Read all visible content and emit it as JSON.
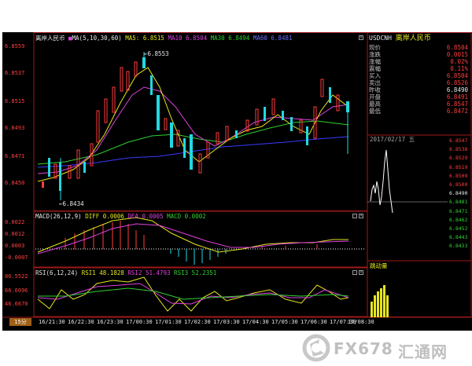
{
  "chart_header": {
    "title": "离岸人民币",
    "ma_label": "MA(5,10,30,60)",
    "ma5": "MA5: 6.8515",
    "ma10": "MA10 6.8504",
    "ma30": "MA30 6.8494",
    "ma60": "MA60 6.8481"
  },
  "price_axis": [
    "6.8559",
    "6.8537",
    "6.8515",
    "6.8493",
    "6.8471",
    "6.8450"
  ],
  "high_label": "6.8553",
  "low_label": "6.8434",
  "macd_header": {
    "label": "MACD(26,12,9)",
    "diff": "DIFF 0.0006",
    "dea": "DEA 0.0005",
    "macd": "MACD 0.0002"
  },
  "macd_axis": [
    "0.0022",
    "0.0012",
    "0.0003",
    "-0.0007"
  ],
  "rsi_header": {
    "label": "RSI(6,12,24)",
    "rsi1": "RSI1 48.1828",
    "rsi2": "RSI2 51.4793",
    "rsi3": "RSI3 52.2351"
  },
  "rsi_axis": [
    "86.5522",
    "66.6096",
    "46.6670"
  ],
  "time_axis": [
    "16/21:30",
    "16/22:30",
    "16/23:30",
    "17/00:30",
    "17/01:30",
    "17/02:30",
    "17/03:30",
    "17/04:30",
    "17/05:30",
    "17/06:30",
    "17/07:30",
    "17/08:30"
  ],
  "period": "15分",
  "quote_panel": {
    "symbol": "USDCNH",
    "name": "离岸人民币",
    "rows": [
      {
        "label": "现价",
        "value": "6.8504"
      },
      {
        "label": "涨跌",
        "value": "0.0015"
      },
      {
        "label": "涨幅",
        "value": "0.02%"
      },
      {
        "label": "震幅",
        "value": "0.11%"
      },
      {
        "label": "买入",
        "value": "6.8504"
      },
      {
        "label": "卖出",
        "value": "6.8526"
      },
      {
        "label": "昨收",
        "value": "6.8490"
      },
      {
        "label": "开盘",
        "value": "6.8491"
      },
      {
        "label": "最高",
        "value": "6.8547"
      },
      {
        "label": "最低",
        "value": "6.8472"
      }
    ]
  },
  "intraday": {
    "header": "2017/02/17 五",
    "axis": [
      "6.8547",
      "6.8538",
      "6.8529",
      "6.8519",
      "6.8509",
      "6.8500",
      "6.8490",
      "6.8481",
      "6.8471",
      "6.8462",
      "6.8452",
      "6.8443",
      "6.8433"
    ],
    "volume_label": "跳动量"
  },
  "watermark": {
    "brand": "FX678",
    "cn": "汇通网"
  },
  "colors": {
    "up": "#ff3c3c",
    "down": "#22d8e0",
    "ma5": "#e6e61e",
    "ma10": "#e040e0",
    "ma30": "#30d030",
    "ma60": "#3a3aff",
    "frame": "#a01818"
  }
}
